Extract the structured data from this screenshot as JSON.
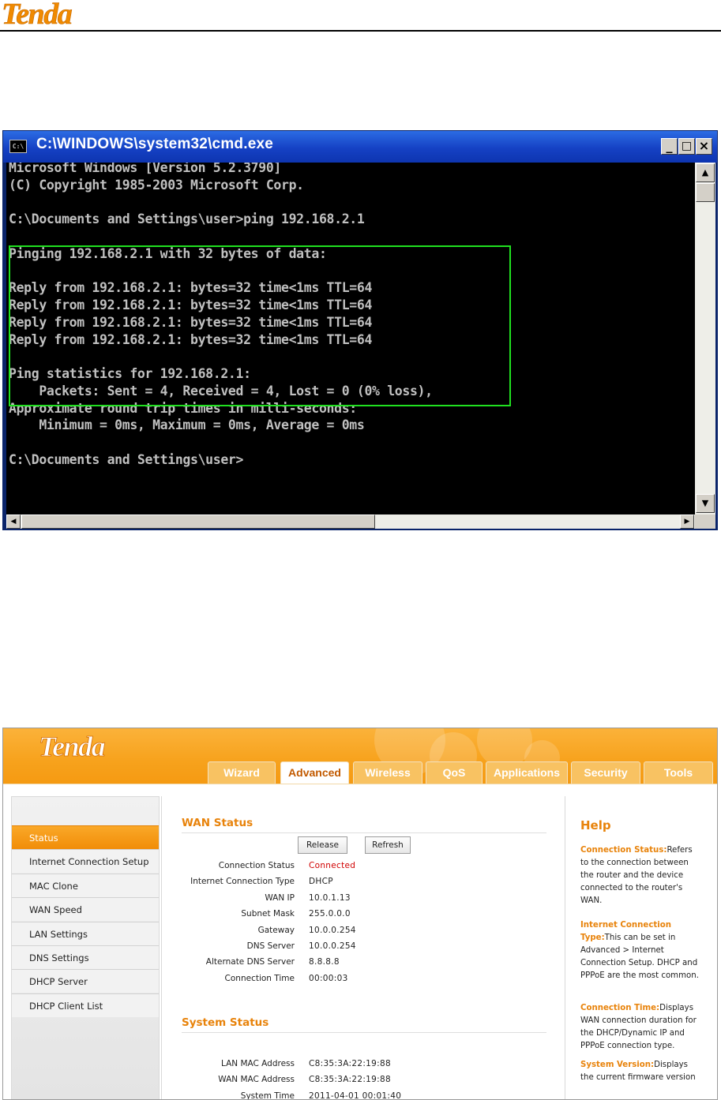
{
  "document": {
    "logo_text": "Tenda"
  },
  "cmd": {
    "title": "C:\\WINDOWS\\system32\\cmd.exe",
    "icon_text": "C:\\",
    "min_symbol": "_",
    "max_symbol": "□",
    "close_symbol": "×",
    "lines": [
      "Microsoft Windows [Version 5.2.3790]",
      "(C) Copyright 1985-2003 Microsoft Corp.",
      "",
      "C:\\Documents and Settings\\user>ping 192.168.2.1",
      "",
      "Pinging 192.168.2.1 with 32 bytes of data:",
      "",
      "Reply from 192.168.2.1: bytes=32 time<1ms TTL=64",
      "Reply from 192.168.2.1: bytes=32 time<1ms TTL=64",
      "Reply from 192.168.2.1: bytes=32 time<1ms TTL=64",
      "Reply from 192.168.2.1: bytes=32 time<1ms TTL=64",
      "",
      "Ping statistics for 192.168.2.1:",
      "    Packets: Sent = 4, Received = 4, Lost = 0 (0% loss),",
      "Approximate round trip times in milli-seconds:",
      "    Minimum = 0ms, Maximum = 0ms, Average = 0ms",
      "",
      "C:\\Documents and Settings\\user>"
    ],
    "highlight_color": "#20e020"
  },
  "router": {
    "logo_text": "Tenda",
    "tabs": [
      "Wizard",
      "Advanced",
      "Wireless",
      "QoS",
      "Applications",
      "Security",
      "Tools"
    ],
    "active_tab": "Advanced",
    "sidebar": [
      "Status",
      "Internet Connection Setup",
      "MAC Clone",
      "WAN Speed",
      "LAN Settings",
      "DNS Settings",
      "DHCP Server",
      "DHCP Client List"
    ],
    "active_sidebar": "Status",
    "wan_title": "WAN Status",
    "wan_rows": [
      {
        "label": "Connection Status",
        "value": "Connected",
        "status": true
      },
      {
        "label": "Internet Connection Type",
        "value": "DHCP"
      },
      {
        "label": "WAN IP",
        "value": "10.0.1.13"
      },
      {
        "label": "Subnet Mask",
        "value": "255.0.0.0"
      },
      {
        "label": "Gateway",
        "value": "10.0.0.254"
      },
      {
        "label": "DNS Server",
        "value": "10.0.0.254"
      },
      {
        "label": "Alternate DNS Server",
        "value": "8.8.8.8"
      },
      {
        "label": "Connection Time",
        "value": "00:00:03"
      }
    ],
    "release_label": "Release",
    "refresh_label": "Refresh",
    "system_title": "System Status",
    "system_rows": [
      {
        "label": "LAN MAC Address",
        "value": "C8:35:3A:22:19:88"
      },
      {
        "label": "WAN MAC Address",
        "value": "C8:35:3A:22:19:88"
      },
      {
        "label": "System Time",
        "value": "2011-04-01 00:01:40"
      }
    ],
    "help_title": "Help",
    "help": [
      {
        "head": "Connection Status:",
        "body": "Refers to the connection between the router and the device connected to the router's WAN."
      },
      {
        "head": "Internet Connection Type:",
        "body": "This can be set in Advanced > Internet Connection Setup. DHCP and PPPoE are the most common."
      },
      {
        "head": "Connection Time:",
        "body": "Displays WAN connection duration for the DHCP/Dynamic IP and PPPoE connection type."
      },
      {
        "head": "System Version:",
        "body": "Displays the current firmware version"
      }
    ],
    "accent_color": "#e8830b",
    "status_color": "#d00000"
  }
}
